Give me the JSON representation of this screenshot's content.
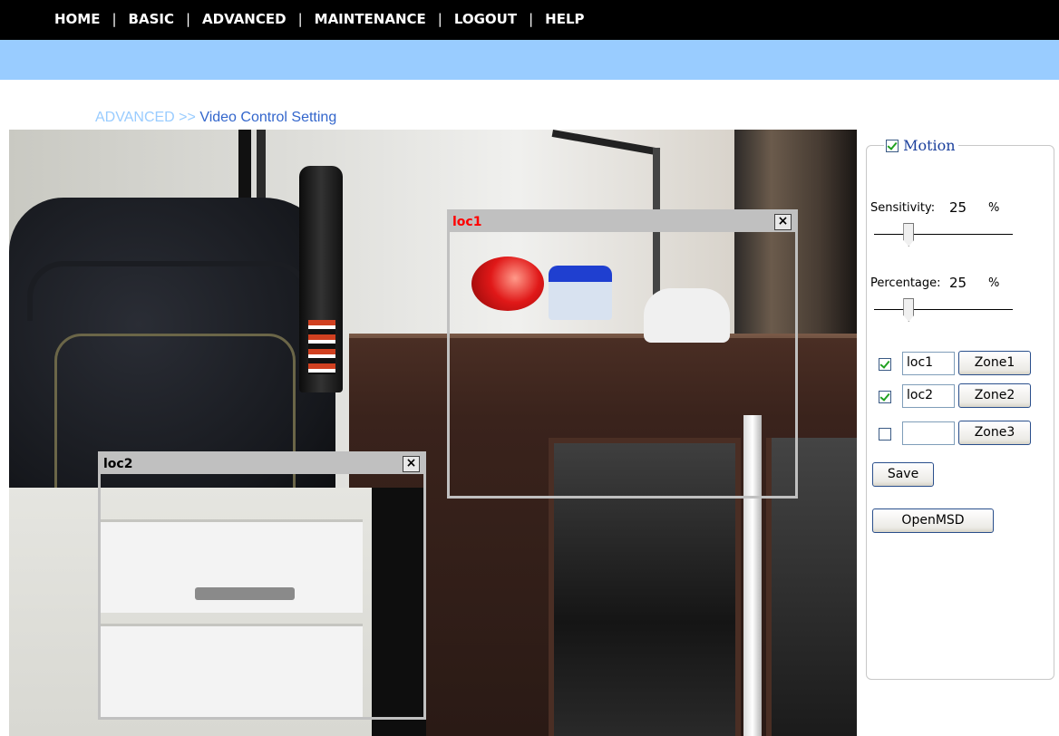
{
  "nav": {
    "items": [
      {
        "label": "HOME"
      },
      {
        "label": "BASIC"
      },
      {
        "label": "ADVANCED"
      },
      {
        "label": "MAINTENANCE"
      },
      {
        "label": "LOGOUT"
      },
      {
        "label": "HELP"
      }
    ],
    "separator": "|"
  },
  "breadcrumb": {
    "parent": "ADVANCED",
    "separator": ">>",
    "current": "Video Control Setting"
  },
  "zones_on_video": [
    {
      "title": "loc1",
      "close": "×",
      "title_color": "#ff0000"
    },
    {
      "title": "loc2",
      "close": "×",
      "title_color": "#000000"
    }
  ],
  "panel": {
    "motion_label": "Motion",
    "motion_checked": true,
    "sensitivity": {
      "label": "Sensitivity:",
      "value": "25",
      "unit": "%",
      "level": 0.25
    },
    "percentage": {
      "label": "Percentage:",
      "value": "25",
      "unit": "%",
      "level": 0.25
    },
    "zones": [
      {
        "checked": true,
        "name": "loc1",
        "button": "Zone1"
      },
      {
        "checked": true,
        "name": "loc2",
        "button": "Zone2"
      },
      {
        "checked": false,
        "name": "",
        "button": "Zone3"
      }
    ],
    "save_label": "Save",
    "openmsd_label": "OpenMSD"
  },
  "colors": {
    "nav_bg": "#000000",
    "banner_bg": "#99ccff",
    "breadcrumb_parent": "#99ccff",
    "breadcrumb_current": "#3366cc",
    "legend_text": "#1a3f9c"
  }
}
